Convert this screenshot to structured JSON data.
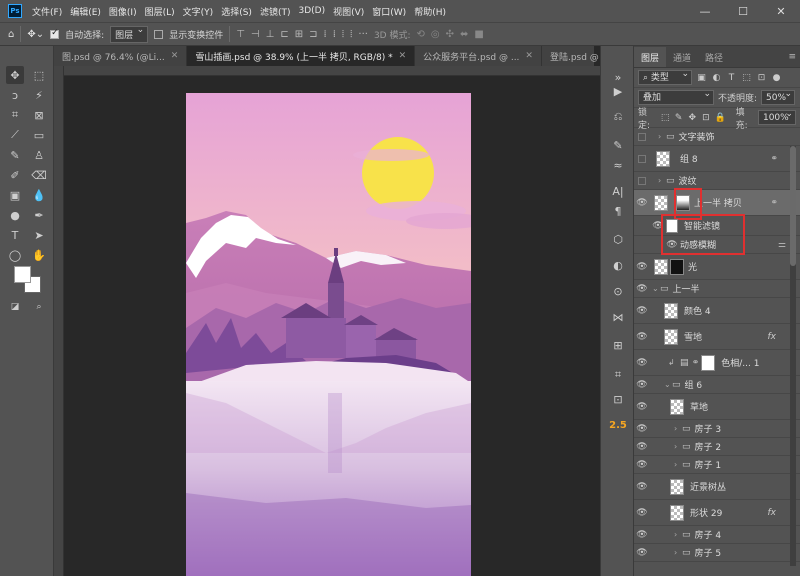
{
  "app": {
    "logo": "Ps"
  },
  "menu": [
    "文件(F)",
    "编辑(E)",
    "图像(I)",
    "图层(L)",
    "文字(Y)",
    "选择(S)",
    "滤镜(T)",
    "3D(D)",
    "视图(V)",
    "窗口(W)",
    "帮助(H)"
  ],
  "window_controls": {
    "minimize": "—",
    "maximize": "☐",
    "close": "✕"
  },
  "options_bar": {
    "auto_select_label": "自动选择:",
    "auto_select_checked": true,
    "auto_select_target": "图层",
    "show_transform_label": "显示变换控件",
    "show_transform_checked": false,
    "mode_3d_label": "3D 模式:"
  },
  "tabs": [
    {
      "label": "图.psd @ 76.4% (@Li...",
      "active": false
    },
    {
      "label": "雪山插画.psd @ 38.9% (上一半 拷贝, RGB/8) *",
      "active": true
    },
    {
      "label": "公众服务平台.psd @ ...",
      "active": false
    },
    {
      "label": "登陆.psd @ 75.1% (...",
      "active": false
    }
  ],
  "tab_close": "✕",
  "tab_overflow": "»",
  "toolbox_icons": [
    "move-icon",
    "marquee-icon",
    "lasso-icon",
    "magic-wand-icon",
    "crop-icon",
    "frame-icon",
    "eyedropper-icon",
    "patch-icon",
    "brush-icon",
    "stamp-icon",
    "history-brush-icon",
    "eraser-icon",
    "gradient-icon",
    "blur-icon",
    "dodge-icon",
    "pen-icon",
    "type-icon",
    "path-select-icon",
    "ellipse-icon",
    "hand-icon",
    "zoom-icon"
  ],
  "dock": {
    "number_badge": "2.5"
  },
  "layers_panel": {
    "tabs": [
      {
        "label": "图层",
        "active": true
      },
      {
        "label": "通道",
        "active": false
      },
      {
        "label": "路径",
        "active": false
      }
    ],
    "filter_kind": "类型",
    "blend_mode": "叠加",
    "opacity_label": "不透明度:",
    "opacity_value": "50%",
    "lock_label": "锁定:",
    "fill_label": "填充:",
    "fill_value": "100%",
    "layers": [
      {
        "name": "文字装饰",
        "kind": "group",
        "visible": false,
        "indent": 0
      },
      {
        "name": "组 8",
        "kind": "smart",
        "visible": false,
        "indent": 0,
        "linked": true
      },
      {
        "name": "波纹",
        "kind": "group",
        "visible": false,
        "indent": 0
      },
      {
        "name": "上一半 拷贝",
        "kind": "smart-masked",
        "visible": true,
        "indent": 0,
        "linked": true,
        "selected": true
      },
      {
        "name": "智能滤镜",
        "kind": "filter-mask",
        "visible": true,
        "indent": 1
      },
      {
        "name": "动感模糊",
        "kind": "filter",
        "visible": true,
        "indent": 2
      },
      {
        "name": "光",
        "kind": "masked",
        "visible": true,
        "indent": 0
      },
      {
        "name": "上一半",
        "kind": "group-open",
        "visible": true,
        "indent": 0
      },
      {
        "name": "颜色 4",
        "kind": "layer",
        "visible": true,
        "indent": 1
      },
      {
        "name": "雪地",
        "kind": "layer",
        "visible": true,
        "indent": 1,
        "fx": true
      },
      {
        "name": "色相/... 1",
        "kind": "adjustment",
        "visible": true,
        "indent": 2
      },
      {
        "name": "组 6",
        "kind": "group-open",
        "visible": true,
        "indent": 1
      },
      {
        "name": "草地",
        "kind": "layer",
        "visible": true,
        "indent": 2
      },
      {
        "name": "房子 3",
        "kind": "group",
        "visible": true,
        "indent": 2
      },
      {
        "name": "房子 2",
        "kind": "group",
        "visible": true,
        "indent": 2
      },
      {
        "name": "房子 1",
        "kind": "group",
        "visible": true,
        "indent": 2
      },
      {
        "name": "近景树丛",
        "kind": "layer",
        "visible": true,
        "indent": 2
      },
      {
        "name": "形状 29",
        "kind": "layer",
        "visible": true,
        "indent": 2,
        "fx": true
      },
      {
        "name": "房子 4",
        "kind": "group",
        "visible": true,
        "indent": 2
      },
      {
        "name": "房子 5",
        "kind": "group",
        "visible": true,
        "indent": 2
      }
    ],
    "fx_label": "fx"
  }
}
